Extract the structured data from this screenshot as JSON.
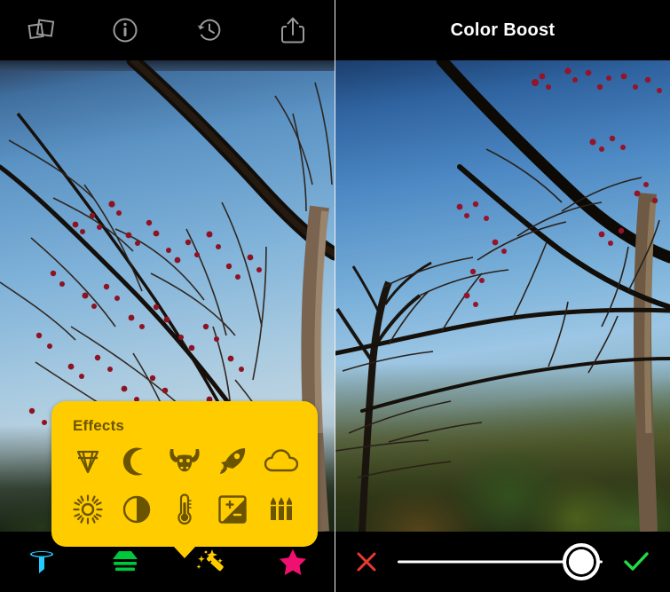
{
  "app": {
    "left_panel_name": "photo-editor-effects-menu",
    "right_panel_name": "photo-editor-color-boost-adjust"
  },
  "left": {
    "toolbar": {
      "items": [
        {
          "icon": "photo-stack-icon",
          "label": "Photos"
        },
        {
          "icon": "info-icon",
          "label": "Info"
        },
        {
          "icon": "history-icon",
          "label": "History"
        },
        {
          "icon": "share-icon",
          "label": "Share"
        }
      ]
    },
    "effects_popup": {
      "title": "Effects",
      "background_color": "#FFCC00",
      "icon_color": "#6B5400",
      "items": [
        {
          "icon": "diamond-icon",
          "label": "Clarity"
        },
        {
          "icon": "moon-icon",
          "label": "Night"
        },
        {
          "icon": "bull-icon",
          "label": "Drama"
        },
        {
          "icon": "rocket-icon",
          "label": "Boost"
        },
        {
          "icon": "cloud-icon",
          "label": "Haze"
        },
        {
          "icon": "sun-icon",
          "label": "Brightness"
        },
        {
          "icon": "contrast-icon",
          "label": "Contrast"
        },
        {
          "icon": "thermometer-icon",
          "label": "Temperature"
        },
        {
          "icon": "exposure-icon",
          "label": "Exposure"
        },
        {
          "icon": "crayons-icon",
          "label": "Color Boost"
        }
      ]
    },
    "bottombar": {
      "items": [
        {
          "icon": "filter-funnel-icon",
          "label": "Filters",
          "color": "#22CCFF",
          "active": false
        },
        {
          "icon": "layers-icon",
          "label": "Layers",
          "color": "#00C83C",
          "active": false
        },
        {
          "icon": "magic-wand-icon",
          "label": "Effects",
          "color": "#FFCC00",
          "active": true
        },
        {
          "icon": "star-icon",
          "label": "Favorites",
          "color": "#F01070",
          "active": false
        }
      ]
    },
    "photo": {
      "description": "Tree branches with red berries against a blue sky"
    }
  },
  "right": {
    "title": "Color Boost",
    "photo": {
      "description": "Trees with green and orange foliage against a blue sky"
    },
    "controls": {
      "cancel": {
        "icon": "close-x-icon",
        "label": "Cancel",
        "color": "#E8392F"
      },
      "confirm": {
        "icon": "checkmark-icon",
        "label": "Apply",
        "color": "#22DD44"
      },
      "slider": {
        "label": "Color Boost amount",
        "value_percent": 87,
        "min": 0,
        "max": 100,
        "track_color": "#FFFFFF",
        "knob_color": "#FFFFFF"
      }
    }
  }
}
